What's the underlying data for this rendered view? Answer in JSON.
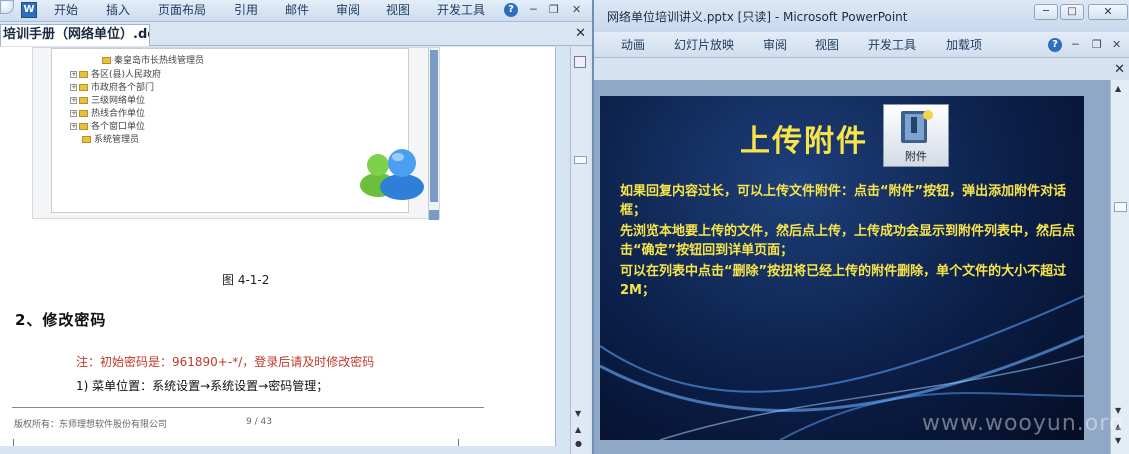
{
  "word": {
    "ribbon_tabs": [
      "开始",
      "插入",
      "页面布局",
      "引用",
      "邮件",
      "审阅",
      "视图",
      "开发工具"
    ],
    "doc_tab": "培训手册（网络单位）.doc",
    "close_glyph": "✕",
    "figure": {
      "tree_items": [
        {
          "label": "秦皇岛市长热线管理员",
          "expandable": false
        },
        {
          "label": "各区(县)人民政府",
          "expandable": true
        },
        {
          "label": "市政府各个部门",
          "expandable": true
        },
        {
          "label": "三级网络单位",
          "expandable": true
        },
        {
          "label": "热线合作单位",
          "expandable": true
        },
        {
          "label": "各个窗口单位",
          "expandable": true
        },
        {
          "label": "系统管理员",
          "expandable": false
        }
      ]
    },
    "caption": "图 4-1-2",
    "heading": "2、修改密码",
    "note": "注：初始密码是：961890+-*/，登录后请及时修改密码",
    "step": "1)    菜单位置：系统设置→系统设置→密码管理；",
    "footer_left": "版权所有：东师理想软件股份有限公司",
    "footer_page": "9 / 43"
  },
  "ppt": {
    "title": "网络单位培训讲义.pptx [只读] - Microsoft PowerPoint",
    "ribbon_tabs": [
      "动画",
      "幻灯片放映",
      "审阅",
      "视图",
      "开发工具",
      "加载项"
    ],
    "slide": {
      "title": "上传附件",
      "attach_label": "附件",
      "paragraphs": [
        "如果回复内容过长，可以上传文件附件：点击“附件”按钮，弹出添加附件对话框；",
        "先浏览本地要上传的文件，然后点上传，上传成功会显示到附件列表中，然后点击“确定”按钮回到详单页面；",
        "可以在列表中点击“删除”按扭将已经上传的附件删除，单个文件的大小不超过2M；"
      ]
    }
  },
  "watermark": "www.wooyun.org",
  "colors": {
    "slide_text": "#f7e44a",
    "note_red": "#c0392b",
    "ribbon_bg": "#dce7f4"
  }
}
